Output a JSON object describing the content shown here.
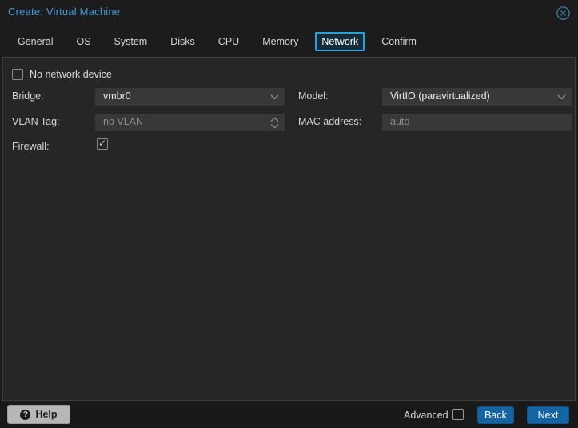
{
  "window": {
    "title": "Create: Virtual Machine"
  },
  "tabs": [
    {
      "label": "General",
      "active": false
    },
    {
      "label": "OS",
      "active": false
    },
    {
      "label": "System",
      "active": false
    },
    {
      "label": "Disks",
      "active": false
    },
    {
      "label": "CPU",
      "active": false
    },
    {
      "label": "Memory",
      "active": false
    },
    {
      "label": "Network",
      "active": true
    },
    {
      "label": "Confirm",
      "active": false
    }
  ],
  "form": {
    "no_network_device": {
      "label": "No network device",
      "checked": false
    },
    "bridge": {
      "label": "Bridge:",
      "value": "vmbr0",
      "control": "combobox"
    },
    "model": {
      "label": "Model:",
      "value": "VirtIO (paravirtualized)",
      "control": "combobox"
    },
    "vlan_tag": {
      "label": "VLAN Tag:",
      "value": "no VLAN",
      "control": "spinner",
      "disabled": true
    },
    "mac_address": {
      "label": "MAC address:",
      "value": "auto",
      "control": "textfield",
      "is_placeholder": true
    },
    "firewall": {
      "label": "Firewall:",
      "checked": true
    }
  },
  "footer": {
    "help": "Help",
    "advanced": {
      "label": "Advanced",
      "checked": false
    },
    "back": "Back",
    "next": "Next"
  },
  "icons": {
    "close": "circled-x-icon",
    "help": "question-circle-icon",
    "combo_trigger": "chevron-down-icon",
    "spinner_trigger": "chevron-up-down-icon"
  },
  "colors": {
    "title_blue": "#3f9cd6",
    "active_tab_border": "#2b9fd9",
    "button_blue": "#1464a3",
    "panel_bg": "#262626",
    "field_bg": "#383838",
    "window_bg": "#1c1c1c"
  }
}
